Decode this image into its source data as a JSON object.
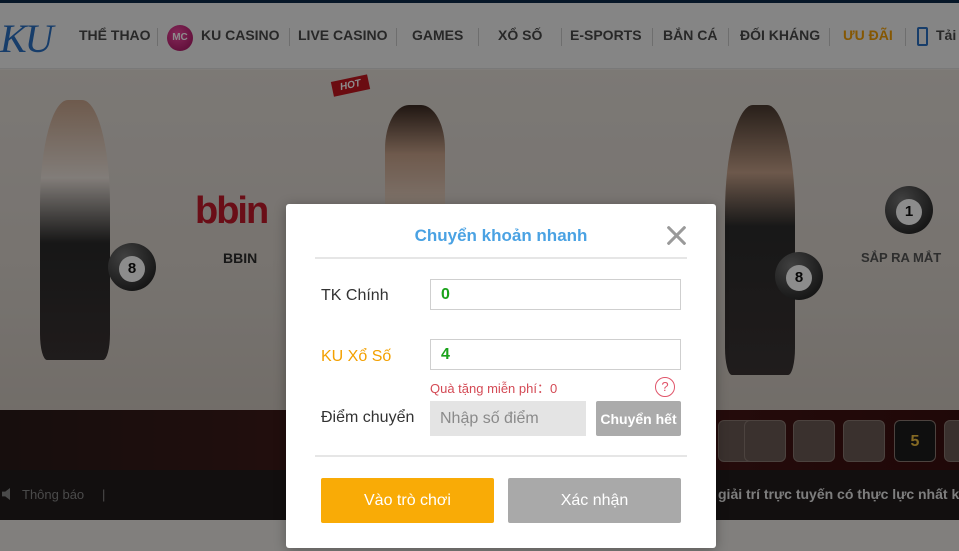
{
  "nav": {
    "logo": "KU",
    "mc_badge": "MC",
    "items": [
      {
        "label": "THỂ THAO"
      },
      {
        "label": "KU CASINO"
      },
      {
        "label": "LIVE CASINO"
      },
      {
        "label": "GAMES"
      },
      {
        "label": "XỔ SỐ"
      },
      {
        "label": "E-SPORTS"
      },
      {
        "label": "BẮN CÁ"
      },
      {
        "label": "ĐỐI KHÁNG"
      },
      {
        "label": "ƯU ĐÃI"
      },
      {
        "label": "Tải"
      }
    ],
    "active_color": "#f29f05"
  },
  "background": {
    "bbin_logo": "bbin",
    "bbin_label": "BBIN",
    "hot_tag": "HOT",
    "soon_label": "SẮP RA MẮT",
    "ball_numbers": [
      "8",
      "8",
      "1"
    ],
    "thumb_5": "5",
    "notice_label": "Thông báo",
    "notice_divider": "|",
    "notice_text": "giải trí trực tuyến có thực lực nhất k"
  },
  "modal": {
    "title": "Chuyển khoản nhanh",
    "main_account": {
      "label": "TK Chính",
      "value": "0"
    },
    "lottery_account": {
      "label": "KU Xổ Số",
      "value": "4"
    },
    "gift_text": "Quà tặng miễn phí：0",
    "help_symbol": "?",
    "points": {
      "label": "Điểm chuyển",
      "placeholder": "Nhập số điểm"
    },
    "transfer_all_label": "Chuyển hết",
    "play_label": "Vào trò chơi",
    "confirm_label": "Xác nhận",
    "colors": {
      "title": "#4aa2e3",
      "value": "#1aa31a",
      "accent": "#f9ab06",
      "gift": "#d44a55"
    }
  }
}
